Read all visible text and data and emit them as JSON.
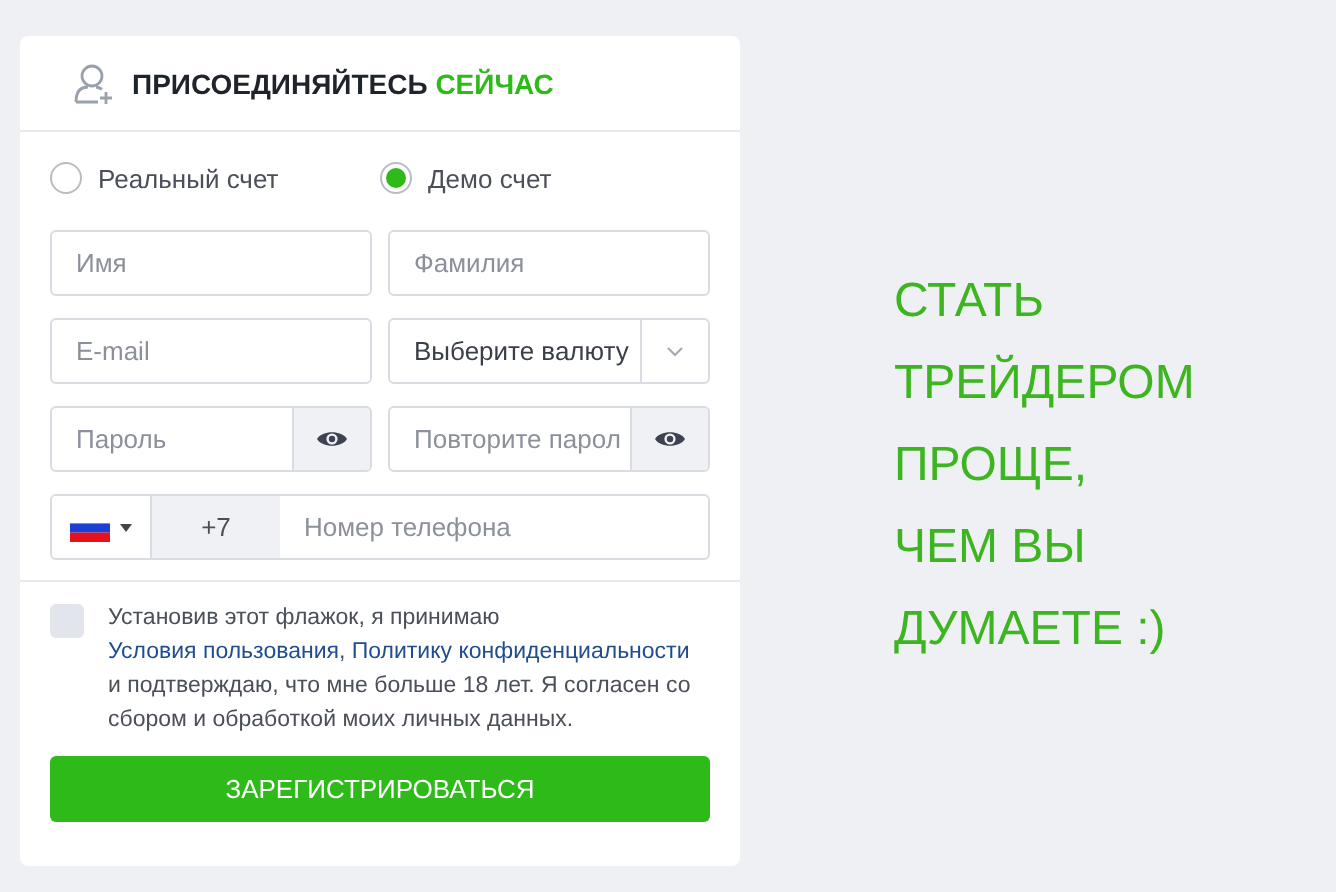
{
  "header": {
    "title": "ПРИСОЕДИНЯЙТЕСЬ",
    "title_accent": "СЕЙЧАС"
  },
  "account_types": [
    {
      "label": "Реальный счет",
      "selected": false
    },
    {
      "label": "Демо счет",
      "selected": true
    }
  ],
  "fields": [
    {
      "kind": "text",
      "placeholder": "Имя"
    },
    {
      "kind": "text",
      "placeholder": "Фамилия"
    },
    {
      "kind": "text",
      "placeholder": "E-mail"
    },
    {
      "kind": "select",
      "value": "Выберите валюту"
    },
    {
      "kind": "password",
      "placeholder": "Пароль"
    },
    {
      "kind": "password",
      "placeholder": "Повторите парол"
    }
  ],
  "phone": {
    "code": "+7",
    "placeholder": "Номер телефона"
  },
  "consent": {
    "checked": false,
    "parts": [
      {
        "kind": "text",
        "text": "Установив этот флажок, я принимаю "
      },
      {
        "kind": "link",
        "text": "Условия пользования"
      },
      {
        "kind": "text",
        "text": ", "
      },
      {
        "kind": "link",
        "text": "Политику конфиденциальности"
      },
      {
        "kind": "text",
        "text": " и подтверждаю, что мне больше 18 лет. Я согласен со сбором и обработкой моих личных данных."
      }
    ]
  },
  "submit": "ЗАРЕГИСТРИРОВАТЬСЯ",
  "slogan_lines": [
    "СТАТЬ",
    "ТРЕЙДЕРОМ",
    "ПРОЩЕ,",
    "ЧЕМ ВЫ",
    "ДУМАЕТЕ :)"
  ]
}
